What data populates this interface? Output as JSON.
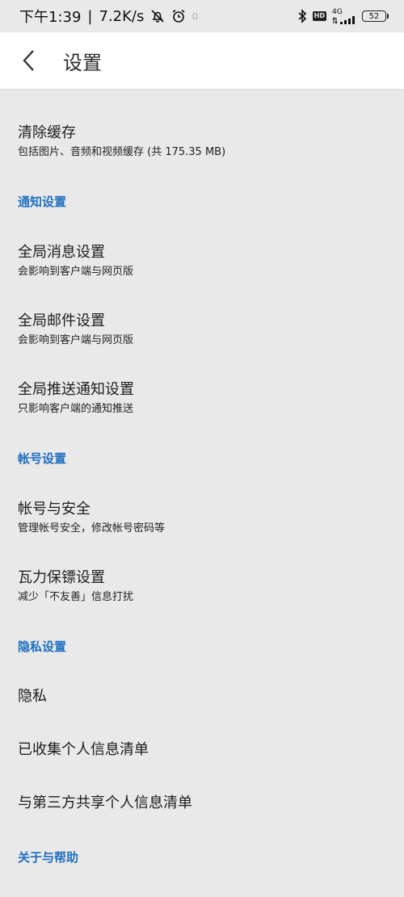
{
  "status_bar": {
    "time": "下午1:39",
    "separator": "|",
    "net_speed": "7.2K/s",
    "network": "4G",
    "hd": "HD",
    "battery": "52"
  },
  "header": {
    "title": "设置"
  },
  "items": {
    "clear_cache": {
      "title": "清除缓存",
      "subtitle": "包括图片、音频和视频缓存 (共 175.35 MB)"
    },
    "global_message": {
      "title": "全局消息设置",
      "subtitle": "会影响到客户端与网页版"
    },
    "global_mail": {
      "title": "全局邮件设置",
      "subtitle": "会影响到客户端与网页版"
    },
    "global_push": {
      "title": "全局推送通知设置",
      "subtitle": "只影响客户端的通知推送"
    },
    "account_security": {
      "title": "帐号与安全",
      "subtitle": "管理帐号安全，修改帐号密码等"
    },
    "wali_guard": {
      "title": "瓦力保镖设置",
      "subtitle": "减少「不友善」信息打扰"
    },
    "privacy": {
      "title": "隐私"
    },
    "collected_info": {
      "title": "已收集个人信息清单"
    },
    "third_party_info": {
      "title": "与第三方共享个人信息清单"
    }
  },
  "sections": {
    "notification": "通知设置",
    "account": "帐号设置",
    "privacy": "隐私设置",
    "about": "关于与帮助"
  },
  "colors": {
    "section_header": "#1f6fbf",
    "background": "#e9e9ea",
    "app_bar": "#ffffff"
  }
}
